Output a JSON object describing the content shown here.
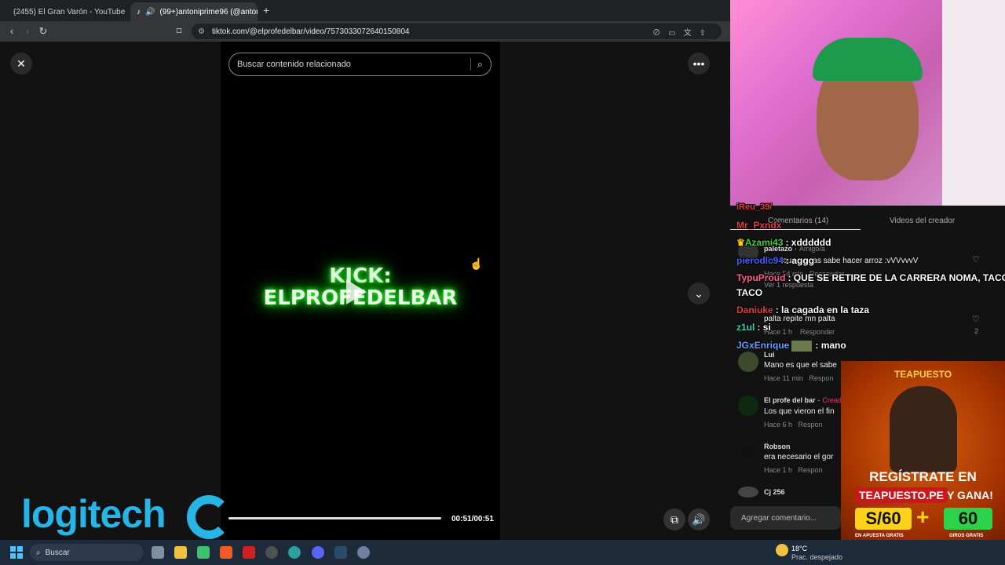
{
  "browser": {
    "tabs": [
      {
        "title": "(2455) El Gran Varón - YouTube",
        "active": false
      },
      {
        "title": "(99+)antoniprime96 (@anton",
        "active": true
      }
    ],
    "url": "tiktok.com/@elprofedelbar/video/7573033072640150804"
  },
  "tiktok": {
    "search_placeholder": "Buscar contenido relacionado",
    "video_text_line1": "KICK:",
    "video_text_line2": "ELPROFEDELBAR",
    "time": "00:51/00:51",
    "progress_fraction": 0.98
  },
  "panel": {
    "tab_comments": "Comentarios (14)",
    "tab_videos": "Videos del creador",
    "comments": [
      {
        "name": "paletazo",
        "tag": "Amigo/a",
        "text": "Tu si que gustas sabe hacer arroz :vVVvvvV",
        "meta": "Hace 54 min",
        "reply": "Responder",
        "likes": "",
        "thread": "Ver 1 respuesta"
      },
      {
        "name": "",
        "tag": "",
        "text": "palta repite mn palta",
        "meta": "Hace 1 h",
        "reply": "Responder",
        "likes": "2",
        "thread": ""
      },
      {
        "name": "Lui",
        "tag": "",
        "text": "Mano es que el sabe",
        "meta": "Hace 11 min",
        "reply": "Respon",
        "likes": "",
        "thread": ""
      },
      {
        "name": "El profe del bar",
        "tag": "Creado",
        "text": "Los que vieron el fin",
        "meta": "Hace 6 h",
        "reply": "Respon",
        "likes": "",
        "thread": ""
      },
      {
        "name": "Robson",
        "tag": "",
        "text": "era necesario el gor",
        "meta": "Hace 1 h",
        "reply": "Respon",
        "likes": "",
        "thread": ""
      },
      {
        "name": "Cj 256",
        "tag": "",
        "text": "",
        "meta": "",
        "reply": "",
        "likes": "",
        "thread": ""
      }
    ],
    "comment_placeholder": "Agregar comentario..."
  },
  "chat": [
    {
      "user": "iReu_39/",
      "msg": "",
      "color": "#e04040"
    },
    {
      "user": "Mr_Pxndx",
      "msg": "",
      "color": "#e04040"
    },
    {
      "user": "Azami43",
      "msg": ": xdddddd",
      "color": "#40d040"
    },
    {
      "user": "pierodlc94",
      "msg": ": aggg",
      "color": "#4060ff"
    },
    {
      "user": "TypuProud",
      "msg": ": QUE SE RETIRE DE LA CARRERA NOMA, TACO",
      "color": "#ff6090"
    },
    {
      "user": "TACO",
      "msg": "",
      "color": "#ffffff"
    },
    {
      "user": "Daniuke",
      "msg": ": la cagada en la taza",
      "color": "#e04040"
    },
    {
      "user": "z1ul",
      "msg": ": si",
      "color": "#40d0c0"
    },
    {
      "user": "JGxEnrique",
      "msg": ": mano",
      "color": "#60a0ff"
    }
  ],
  "ad": {
    "brand": "TEAPUESTO",
    "line1": "REGÍSTRATE EN",
    "line2": "TEAPUESTO.PE",
    "line3": "Y GANA!",
    "amount1": "S/60",
    "plus": "+",
    "amount2": "60",
    "sub1": "EN APUESTA GRATIS",
    "sub2": "GIROS GRATIS"
  },
  "overlay": {
    "logo": "logitech"
  },
  "taskbar": {
    "search": "Buscar",
    "temp": "18°C",
    "weather": "Prac. despejado"
  }
}
